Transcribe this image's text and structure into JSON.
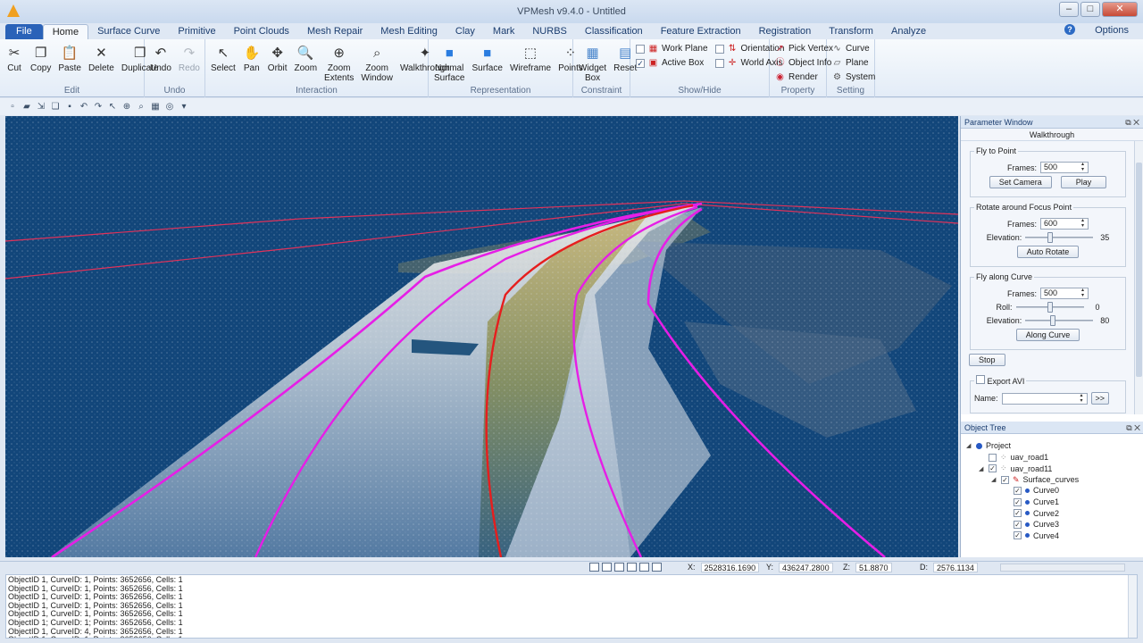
{
  "window": {
    "title": "VPMesh v9.4.0 - Untitled",
    "min": "–",
    "max": "□",
    "close": "✕"
  },
  "tabs": [
    "File",
    "Home",
    "Surface Curve",
    "Primitive",
    "Point Clouds",
    "Mesh Repair",
    "Mesh Editing",
    "Clay",
    "Mark",
    "NURBS",
    "Classification",
    "Feature Extraction",
    "Registration",
    "Transform",
    "Analyze"
  ],
  "help_label": "?",
  "options_label": "Options",
  "ribbon": {
    "edit": {
      "label": "Edit",
      "buttons": [
        {
          "label": "Cut",
          "icon": "✂"
        },
        {
          "label": "Copy",
          "icon": "❐"
        },
        {
          "label": "Paste",
          "icon": "📋"
        },
        {
          "label": "Delete",
          "icon": "✕"
        },
        {
          "label": "Duplicate",
          "icon": "❒"
        }
      ]
    },
    "undo": {
      "label": "Undo",
      "buttons": [
        {
          "label": "Undo",
          "icon": "↶"
        },
        {
          "label": "Redo",
          "icon": "↷"
        }
      ]
    },
    "interaction": {
      "label": "Interaction",
      "buttons": [
        {
          "label": "Select",
          "icon": "↖"
        },
        {
          "label": "Pan",
          "icon": "✋"
        },
        {
          "label": "Orbit",
          "icon": "✥"
        },
        {
          "label": "Zoom",
          "icon": "🔍"
        },
        {
          "label": "Zoom\nExtents",
          "icon": "⊕"
        },
        {
          "label": "Zoom\nWindow",
          "icon": "⌕"
        },
        {
          "label": "Walkthrough",
          "icon": "✦"
        }
      ]
    },
    "representation": {
      "label": "Representation",
      "buttons": [
        {
          "label": "Normal\nSurface",
          "icon": "■"
        },
        {
          "label": "Surface",
          "icon": "■"
        },
        {
          "label": "Wireframe",
          "icon": "⬚"
        },
        {
          "label": "Points",
          "icon": "⁘"
        }
      ]
    },
    "constraint": {
      "label": "Constraint",
      "buttons": [
        {
          "label": "Widget\nBox",
          "icon": "▦"
        },
        {
          "label": "Reset",
          "icon": "▤"
        }
      ]
    },
    "showhide": {
      "label": "Show/Hide",
      "col1": [
        {
          "label": "Work Plane",
          "checked": false,
          "icon": "▦"
        },
        {
          "label": "Active Box",
          "checked": true,
          "icon": "▣"
        }
      ],
      "col2": [
        {
          "label": "Orientation",
          "checked": false,
          "icon": "⇅"
        },
        {
          "label": "World Axis",
          "checked": false,
          "icon": "✛"
        }
      ]
    },
    "property": {
      "label": "Property",
      "items": [
        {
          "label": "Pick Vertex",
          "icon": "↗"
        },
        {
          "label": "Object Info",
          "icon": "ⓘ"
        },
        {
          "label": "Render",
          "icon": "◉"
        }
      ]
    },
    "setting": {
      "label": "Setting",
      "items": [
        {
          "label": "Curve",
          "icon": "∿"
        },
        {
          "label": "Plane",
          "icon": "▱"
        },
        {
          "label": "System",
          "icon": "⚙"
        }
      ]
    }
  },
  "parameter_window": {
    "title": "Parameter Window",
    "mode": "Walkthrough",
    "fly_to_point": {
      "legend": "Fly to Point",
      "frames_label": "Frames:",
      "frames": "500",
      "set_camera": "Set Camera",
      "play": "Play"
    },
    "rotate": {
      "legend": "Rotate around Focus Point",
      "frames_label": "Frames:",
      "frames": "600",
      "elevation_label": "Elevation:",
      "elevation": "35",
      "elevation_pct": 0.35,
      "button": "Auto Rotate"
    },
    "fly_along": {
      "legend": "Fly along Curve",
      "frames_label": "Frames:",
      "frames": "500",
      "roll_label": "Roll:",
      "roll": "0",
      "roll_pct": 0.5,
      "elevation_label": "Elevation:",
      "elevation": "80",
      "elevation_pct": 0.4,
      "button": "Along Curve"
    },
    "stop": "Stop",
    "export": {
      "legend": "Export AVI",
      "name_label": "Name:",
      "browse": ">>"
    }
  },
  "object_tree": {
    "title": "Object Tree",
    "items": [
      {
        "label": "Project",
        "level": 0,
        "toggle": "◢",
        "check": false
      },
      {
        "label": "uav_road1",
        "level": 1,
        "toggle": "",
        "check": true,
        "checked": false
      },
      {
        "label": "uav_road11",
        "level": 1,
        "toggle": "◢",
        "check": true,
        "checked": true
      },
      {
        "label": "Surface_curves",
        "level": 2,
        "toggle": "◢",
        "check": true,
        "checked": true
      },
      {
        "label": "Curve0",
        "level": 3,
        "toggle": "",
        "check": true,
        "checked": true
      },
      {
        "label": "Curve1",
        "level": 3,
        "toggle": "",
        "check": true,
        "checked": true
      },
      {
        "label": "Curve2",
        "level": 3,
        "toggle": "",
        "check": true,
        "checked": true
      },
      {
        "label": "Curve3",
        "level": 3,
        "toggle": "",
        "check": true,
        "checked": true
      },
      {
        "label": "Curve4",
        "level": 3,
        "toggle": "",
        "check": true,
        "checked": true
      }
    ]
  },
  "status": {
    "x_label": "X:",
    "x": "2528316.1690",
    "y_label": "Y:",
    "y": "436247.2800",
    "z_label": "Z:",
    "z": "51.8870",
    "d_label": "D:",
    "d": "2576.1134"
  },
  "output_lines": [
    "ObjectID 1, CurveID: 1, Points: 3652656, Cells: 1",
    "ObjectID 1, CurveID: 1, Points: 3652656, Cells: 1",
    "ObjectID 1, CurveID: 1, Points: 3652656, Cells: 1",
    "ObjectID 1, CurveID: 1, Points: 3652656, Cells: 1",
    "ObjectID 1, CurveID: 1, Points: 3652656, Cells: 1",
    "ObjectID 1; CurveID: 1; Points: 3652656, Cells: 1",
    "ObjectID 1, CurveID: 4, Points: 3652656, Cells: 1",
    "ObjectID 1, CurveID: 1, Points: 3652656, Cells: 1"
  ],
  "colors": {
    "viewport_bg": "#12467a",
    "curve_magenta": "#e61ee6",
    "curve_red": "#e61e1e",
    "ribbon_accent": "#2a62b8"
  }
}
